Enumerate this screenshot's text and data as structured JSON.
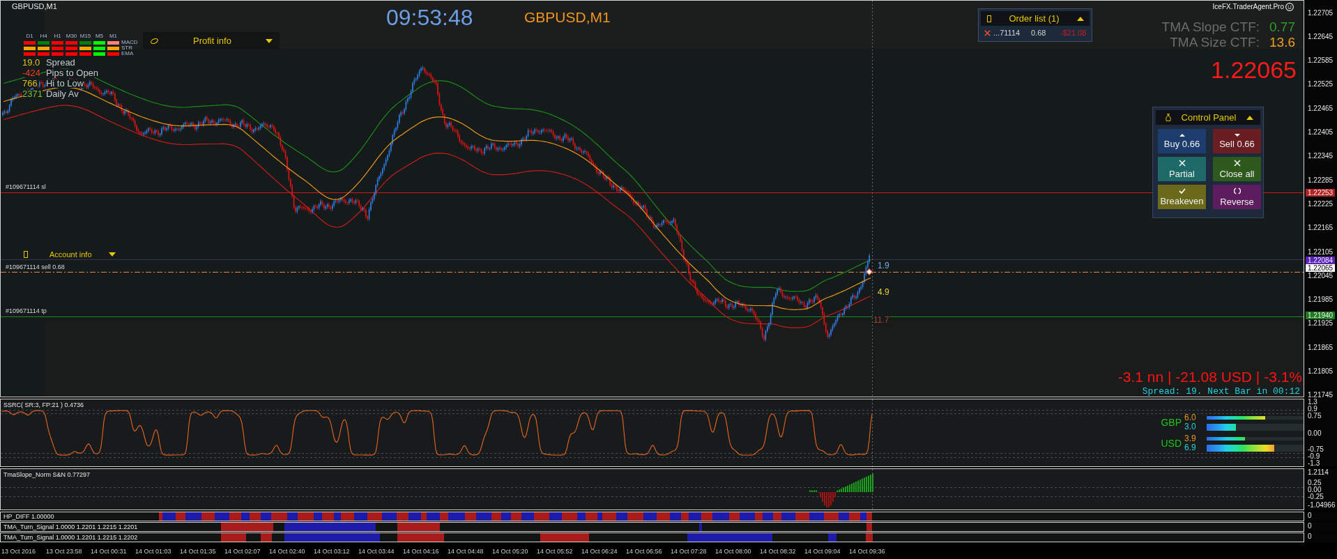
{
  "chart_header": {
    "symbol": "GBPUSD,M1",
    "clock": "09:53:48",
    "title": "GBPUSD,M1"
  },
  "indicator_grid": {
    "timeframes": [
      "D1",
      "H4",
      "H1",
      "M30",
      "M15",
      "M5",
      "M1"
    ],
    "rows": [
      {
        "label": "MACD",
        "cells": [
          {
            "color": "#ff0000"
          },
          {
            "color": "#008000"
          },
          {
            "color": "#ff0000"
          },
          {
            "color": "#ff0000"
          },
          {
            "color": "#008000"
          },
          {
            "color": "#00ff00"
          },
          {
            "color": "#ff8080"
          }
        ]
      },
      {
        "label": "STR",
        "cells": [
          {
            "color": "#ffa500"
          },
          {
            "color": "#ffa500"
          },
          {
            "color": "#ff0000"
          },
          {
            "color": "#ff0000"
          },
          {
            "color": "#ffa500"
          },
          {
            "color": "#00ff00"
          },
          {
            "color": "#ffa500"
          }
        ]
      },
      {
        "label": "EMA",
        "cells": [
          {
            "color": "#ff0000"
          },
          {
            "color": "#ff0000"
          },
          {
            "color": "#ff0000"
          },
          {
            "color": "#ff0000"
          },
          {
            "color": "#ff0000"
          },
          {
            "color": "#00ff00"
          },
          {
            "color": "#ff0000"
          }
        ]
      }
    ]
  },
  "profit_info": {
    "title": "Profit info",
    "expanded": false
  },
  "stats": [
    {
      "figure": "19.0",
      "name": "Spread",
      "color": "#e0c020"
    },
    {
      "figure": "-424",
      "name": "Pips to Open",
      "color": "#f04020"
    },
    {
      "figure": "766",
      "name": "Hi to Low",
      "color": "#e0c020"
    },
    {
      "figure": "2371",
      "name": "Daily Av",
      "color": "#80c030"
    }
  ],
  "order_list": {
    "title": "Order list (1)",
    "expanded": true,
    "orders": [
      {
        "ticket": "...71114",
        "lots": "0.68",
        "profit": "-$21.08"
      }
    ]
  },
  "brand": "IceFX.TraderAgent.Pro",
  "tma_readout": [
    {
      "label": "TMA Slope CTF:",
      "value": "0.77",
      "color": "#2f9e2f"
    },
    {
      "label": "TMA Size CTF:",
      "value": "13.6",
      "color": "#f0a020"
    }
  ],
  "bid_price": "1.22065",
  "control_panel": {
    "title": "Control Panel",
    "expanded": true,
    "buttons": [
      {
        "label": "Buy 0.66",
        "kind": "buy"
      },
      {
        "label": "Sell 0.66",
        "kind": "sell"
      },
      {
        "label": "Partial",
        "kind": "partial"
      },
      {
        "label": "Close all",
        "kind": "close_all"
      },
      {
        "label": "Breakeven",
        "kind": "breakeven"
      },
      {
        "label": "Reverse",
        "kind": "reverse"
      }
    ]
  },
  "order_lines": [
    {
      "label": "#109671114 sl",
      "kind": "sl"
    },
    {
      "label": "#109671114 sell 0.68",
      "kind": "entry"
    },
    {
      "label": "#109671114 tp",
      "kind": "tp"
    }
  ],
  "account_info": {
    "title": "Account info",
    "expanded": false
  },
  "band_values": [
    {
      "text": "1.9",
      "color": "#7aa6e6"
    },
    {
      "text": "4.9",
      "color": "#e8d040"
    },
    {
      "text": "11.7",
      "color": "#a8402a"
    }
  ],
  "position_summary": "-3.1 nn | -21.08 USD | -3.1%",
  "spread_timer": "Spread: 19. Next Bar in 00:12",
  "price_axis": [
    {
      "text": "1.22705",
      "kind": "tick"
    },
    {
      "text": "1.22645",
      "kind": "tick"
    },
    {
      "text": "1.22585",
      "kind": "tick"
    },
    {
      "text": "1.22525",
      "kind": "tick"
    },
    {
      "text": "1.22465",
      "kind": "tick"
    },
    {
      "text": "1.22405",
      "kind": "tick"
    },
    {
      "text": "1.22345",
      "kind": "tick"
    },
    {
      "text": "1.22285",
      "kind": "tick"
    },
    {
      "text": "1.22253",
      "kind": "marker",
      "color": "#b22222"
    },
    {
      "text": "1.22225",
      "kind": "tick"
    },
    {
      "text": "1.22165",
      "kind": "tick"
    },
    {
      "text": "1.22105",
      "kind": "tick"
    },
    {
      "text": "1.22084",
      "kind": "marker",
      "color": "#5a22b4"
    },
    {
      "text": "1.22065",
      "kind": "marker",
      "color": "#ffffff"
    },
    {
      "text": "1.22045",
      "kind": "tick"
    },
    {
      "text": "1.21985",
      "kind": "tick"
    },
    {
      "text": "1.21940",
      "kind": "marker",
      "color": "#1e7a1e"
    },
    {
      "text": "1.21925",
      "kind": "tick"
    },
    {
      "text": "1.21865",
      "kind": "tick"
    },
    {
      "text": "1.21805",
      "kind": "tick"
    },
    {
      "text": "1.21745",
      "kind": "tick"
    }
  ],
  "subwindows": [
    {
      "kind": "ssrc",
      "title": "SSRC( SR:3, FP:21 ) 0.4736",
      "axis_labels": [
        "1.3",
        "0.9",
        "0.75",
        "0.00",
        "-0.75",
        "-0.9",
        "-1.3"
      ],
      "currency_strength": [
        {
          "currency": "GBP",
          "readings": [
            {
              "value": "6.0",
              "level": 0.6,
              "color": "#e8961e"
            },
            {
              "value": "3.0",
              "level": 0.3,
              "color": "#22d0e0"
            }
          ]
        },
        {
          "currency": "USD",
          "readings": [
            {
              "value": "3.9",
              "level": 0.39,
              "color": "#e8961e"
            },
            {
              "value": "6.9",
              "level": 0.69,
              "color": "#22d0e0"
            }
          ]
        }
      ]
    },
    {
      "kind": "slope",
      "title": "TmaSlope_Norm S&N 0.77297",
      "axis_labels": [
        "1.2114",
        "0.25",
        "0.00",
        "-0.25",
        "-1.04966"
      ]
    },
    {
      "kind": "hp_diff",
      "title": "HP_DIFF 1.00000",
      "axis_labels": [
        "0"
      ]
    },
    {
      "kind": "turn_signal",
      "title": "TMA_Turn_Signal 1.0000 1.2201 1.2215 1.2201",
      "axis_labels": [
        "0"
      ]
    },
    {
      "kind": "turn_signal",
      "title": "TMA_Turn_Signal 1.0000 1.2201 1.2215 1.2202",
      "axis_labels": [
        "0"
      ]
    }
  ],
  "time_axis": [
    "13 Oct 2016",
    "13 Oct 23:58",
    "14 Oct 00:31",
    "14 Oct 01:03",
    "14 Oct 01:35",
    "14 Oct 02:07",
    "14 Oct 02:40",
    "14 Oct 03:12",
    "14 Oct 03:44",
    "14 Oct 04:16",
    "14 Oct 04:48",
    "14 Oct 05:20",
    "14 Oct 05:52",
    "14 Oct 06:24",
    "14 Oct 06:56",
    "14 Oct 07:28",
    "14 Oct 08:00",
    "14 Oct 08:32",
    "14 Oct 09:04",
    "14 Oct 09:36"
  ]
}
